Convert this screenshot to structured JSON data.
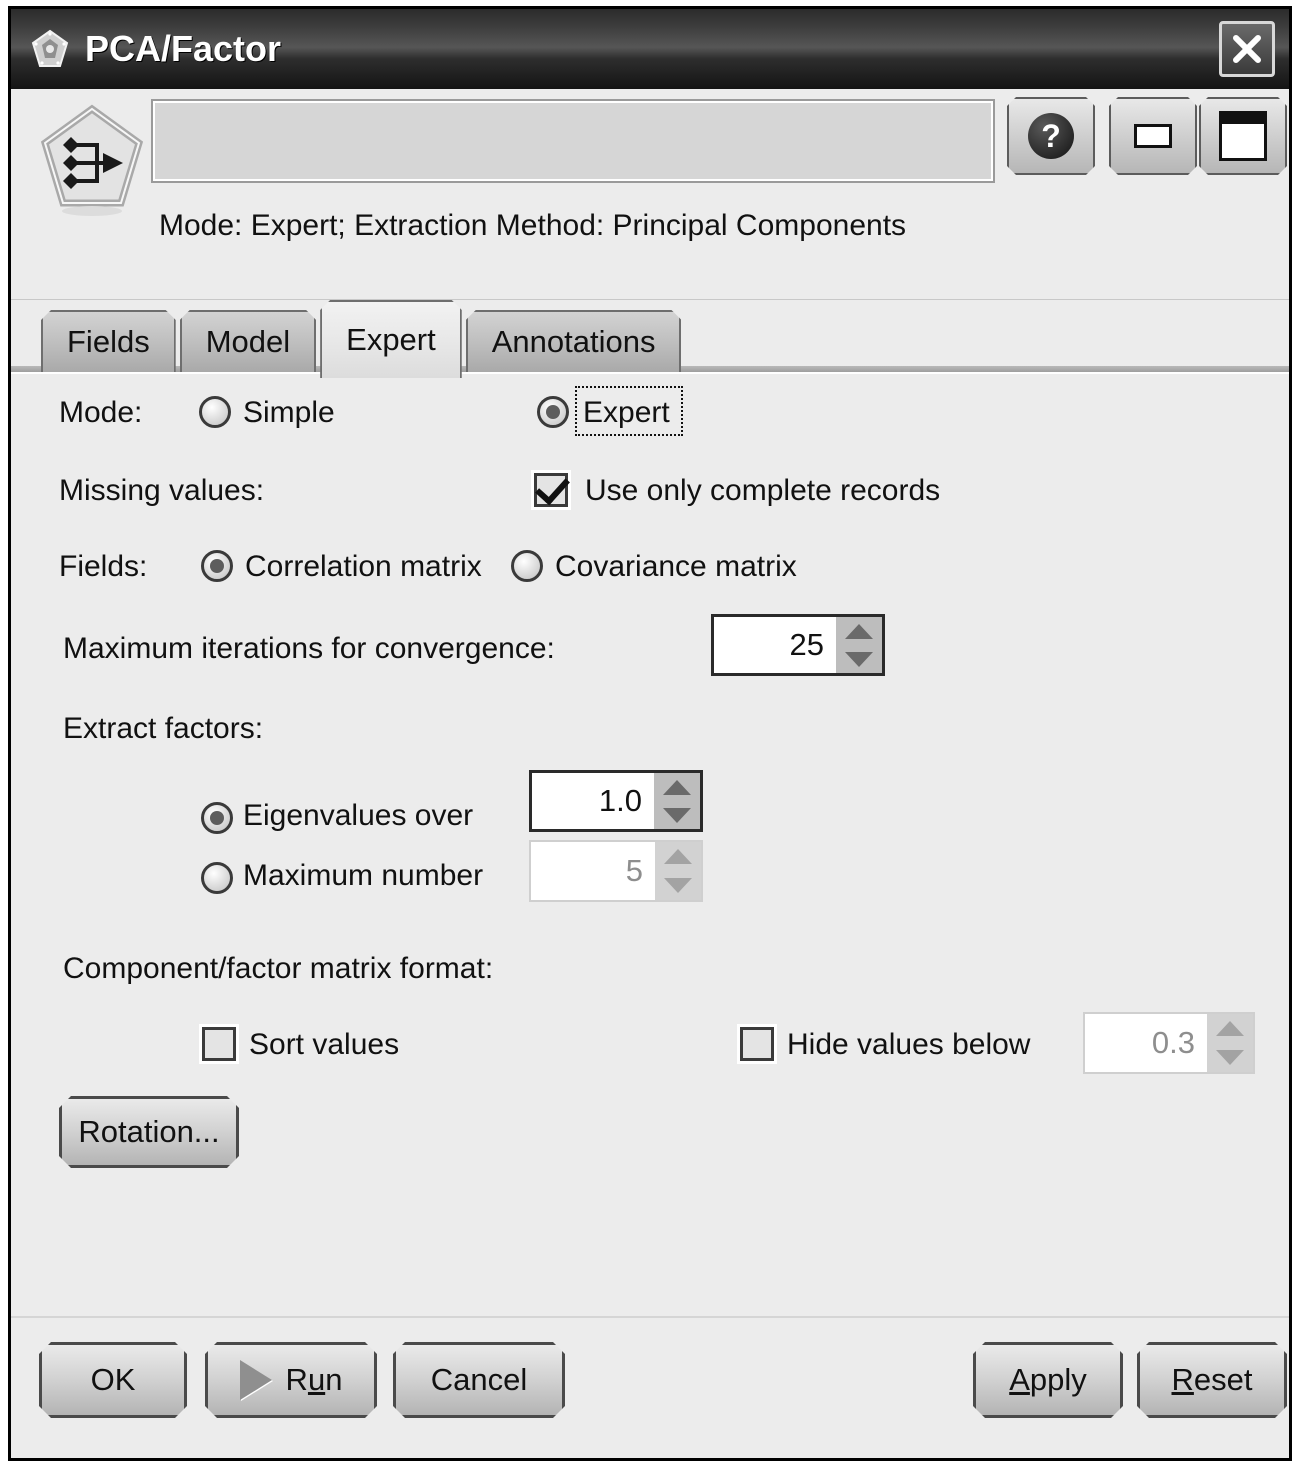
{
  "window": {
    "title": "PCA/Factor",
    "title_icon": "gem-icon",
    "close_label": "✕"
  },
  "header": {
    "node_icon": "pca-node-icon",
    "path_value": "",
    "path_placeholder": "",
    "help_label": "?",
    "minimize_label": "–",
    "maximize_label": "■",
    "summary": "Mode: Expert; Extraction Method: Principal Components"
  },
  "tabs": [
    {
      "label": "Fields",
      "active": false
    },
    {
      "label": "Model",
      "active": false
    },
    {
      "label": "Expert",
      "active": true
    },
    {
      "label": "Annotations",
      "active": false
    }
  ],
  "form": {
    "mode_label": "Mode:",
    "mode_simple": "Simple",
    "mode_expert": "Expert",
    "mode_selected": "Expert",
    "missing_label": "Missing values:",
    "missing_option": "Use only complete records",
    "missing_checked": true,
    "fields_label": "Fields:",
    "fields_correlation": "Correlation matrix",
    "fields_covariance": "Covariance matrix",
    "fields_selected": "Correlation matrix",
    "max_iterations_label": "Maximum iterations for convergence:",
    "max_iterations_value": "25",
    "extract_label": "Extract factors:",
    "eigen_label": "Eigenvalues over",
    "eigen_value": "1.0",
    "eigen_selected": true,
    "maxnum_label": "Maximum number",
    "maxnum_value": "5",
    "maxnum_selected": false,
    "matrix_format_label": "Component/factor matrix format:",
    "sort_values_label": "Sort values",
    "sort_values_checked": false,
    "hide_values_label": "Hide values below",
    "hide_values_checked": false,
    "hide_values_value": "0.3",
    "rotation_button": "Rotation..."
  },
  "footer": {
    "ok": "OK",
    "run_pre": "R",
    "run_mn": "u",
    "run_post": "n",
    "cancel": "Cancel",
    "apply_mn": "A",
    "apply_post": "pply",
    "reset_mn": "R",
    "reset_post": "eset",
    "run_icon": "play-icon"
  },
  "colors": {
    "dialog_bg": "#ececec",
    "titlebar": "#2b2b2b",
    "border": "#000000",
    "disabled_text": "#8e8e8e"
  }
}
